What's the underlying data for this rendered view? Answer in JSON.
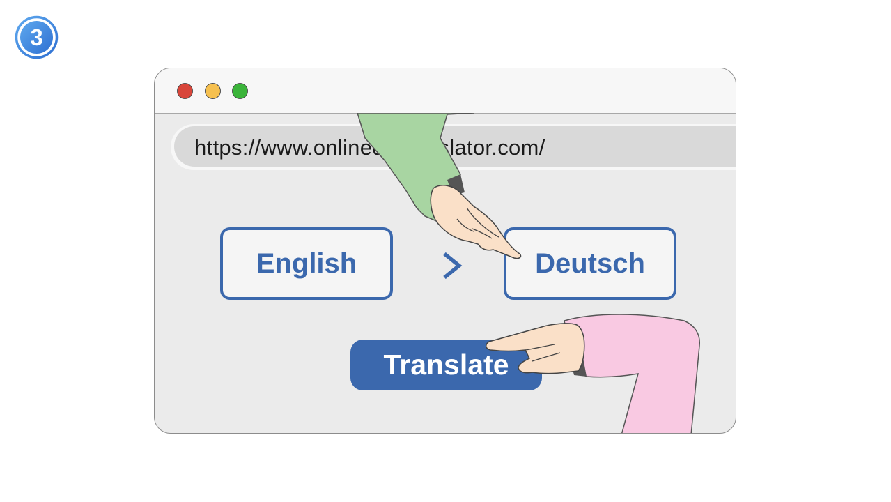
{
  "step": {
    "number": "3",
    "color": "#3f86dd"
  },
  "window": {
    "controls": [
      "close",
      "minimize",
      "maximize"
    ],
    "control_colors": {
      "close": "#d8453a",
      "minimize": "#f6c04f",
      "maximize": "#3bb43a"
    }
  },
  "address_bar": {
    "url": "https://www.onlinedictranslator.com/"
  },
  "translator": {
    "source_language": "English",
    "target_language": "Deutsch",
    "arrow_icon": "chevron-right-icon",
    "translate_label": "Translate",
    "accent_color": "#3b68ad"
  },
  "illustration": {
    "green_hand": "pointing-hand-green-sleeve",
    "pink_hand": "pointing-hand-pink-sleeve"
  }
}
